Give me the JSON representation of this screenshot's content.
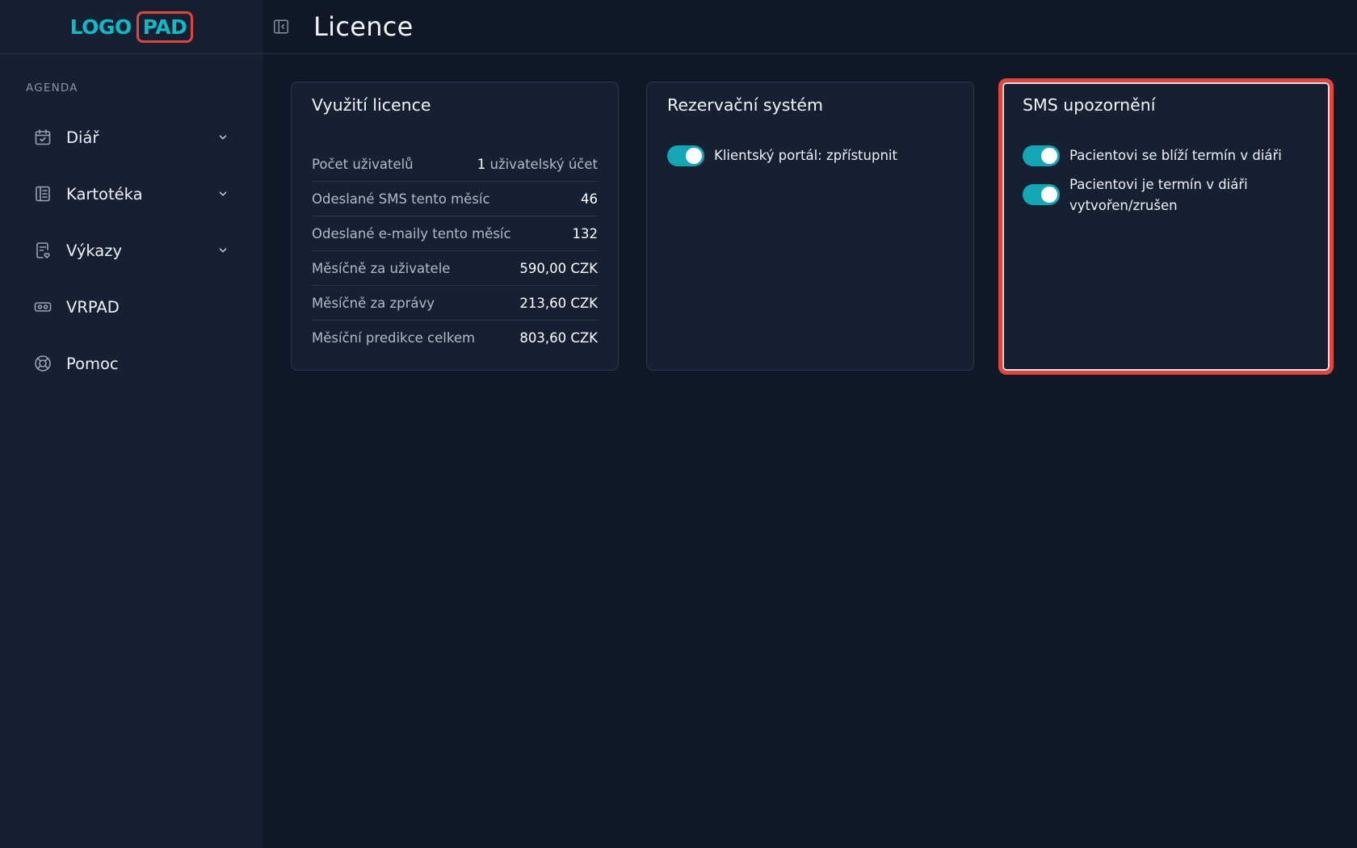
{
  "logo": {
    "part1": "LOGO",
    "part2": "PAD"
  },
  "sidebar": {
    "section_label": "AGENDA",
    "items": [
      {
        "label": "Diář",
        "icon": "calendar-check-icon",
        "expandable": true
      },
      {
        "label": "Kartotéka",
        "icon": "file-cabinet-icon",
        "expandable": true
      },
      {
        "label": "Výkazy",
        "icon": "report-icon",
        "expandable": true
      },
      {
        "label": "VRPAD",
        "icon": "vr-headset-icon",
        "expandable": false
      },
      {
        "label": "Pomoc",
        "icon": "lifebuoy-icon",
        "expandable": false
      }
    ]
  },
  "header": {
    "title": "Licence",
    "collapse_icon": "sidebar-collapse-icon"
  },
  "cards": {
    "license": {
      "title": "Využití licence",
      "rows": [
        {
          "label": "Počet uživatelů",
          "value_num": "1",
          "value_unit": "uživatelský účet"
        },
        {
          "label": "Odeslané SMS tento měsíc",
          "value_num": "46",
          "value_unit": ""
        },
        {
          "label": "Odeslané e-maily tento měsíc",
          "value_num": "132",
          "value_unit": ""
        },
        {
          "label": "Měsíčně za uživatele",
          "value_num": "590,00 CZK",
          "value_unit": ""
        },
        {
          "label": "Měsíčně za zprávy",
          "value_num": "213,60 CZK",
          "value_unit": ""
        },
        {
          "label": "Měsíční predikce celkem",
          "value_num": "803,60 CZK",
          "value_unit": ""
        }
      ]
    },
    "reservation": {
      "title": "Rezervační systém",
      "toggles": [
        {
          "label": "Klientský portál: zpřístupnit",
          "on": true
        }
      ]
    },
    "sms": {
      "title": "SMS upozornění",
      "toggles": [
        {
          "label": "Pacientovi se blíží termín v diáři",
          "on": true
        },
        {
          "label": "Pacientovi je termín v diáři vytvořen/zrušen",
          "on": true
        }
      ]
    }
  },
  "colors": {
    "accent": "#14a6b4",
    "highlight": "#e0463d",
    "background": "#111827",
    "sidebar": "#172033"
  }
}
